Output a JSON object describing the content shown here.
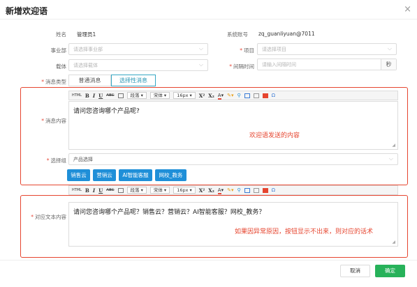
{
  "dialog": {
    "title": "新增欢迎语",
    "close_icon": "×"
  },
  "form": {
    "name_label": "姓名",
    "name_value": "管理员1",
    "account_label": "系统账号",
    "account_value": "zq_guanliyuan@7011",
    "dept_label": "事业部",
    "dept_placeholder": "请选择事业部",
    "project_label": "项目",
    "project_placeholder": "请选择项目",
    "channel_label": "载体",
    "channel_placeholder": "请选择载体",
    "interval_label": "间隔时间",
    "interval_placeholder": "请输入间隔时间",
    "interval_unit": "秒",
    "msgtype_label": "消息类型",
    "tabs": [
      "普通消息",
      "选择性消息"
    ],
    "content_label": "消息内容",
    "product_label": "选择组",
    "product_placeholder": "产品选择",
    "reply_label": "对应文本内容"
  },
  "toolbar": {
    "paragraph": "段落",
    "font": "宋体",
    "size": "16px",
    "bold": "B",
    "italic": "I",
    "underline": "U",
    "strike": "ABC",
    "superscript": "X²",
    "subscript": "X₂",
    "font_color": "A",
    "source": "HTML"
  },
  "editor1": {
    "text": "请问您咨询哪个产品呢?",
    "annotation": "欢迎语发送的内容"
  },
  "products": [
    "销售云",
    "营销云",
    "AI智能客服",
    "网校_教务"
  ],
  "editor2": {
    "text": "请问您咨询哪个产品呢？销售云？营销云？AI智能客服？网校_教务？",
    "annotation": "如果因异常原因，按钮显示不出来，则对应的话术"
  },
  "footer": {
    "cancel": "取消",
    "confirm": "确定"
  },
  "colors": {
    "accent_red": "#e6452f",
    "primary_blue": "#1f8fd8",
    "confirm_green": "#27b25a",
    "tab_active": "#36a7c4"
  }
}
